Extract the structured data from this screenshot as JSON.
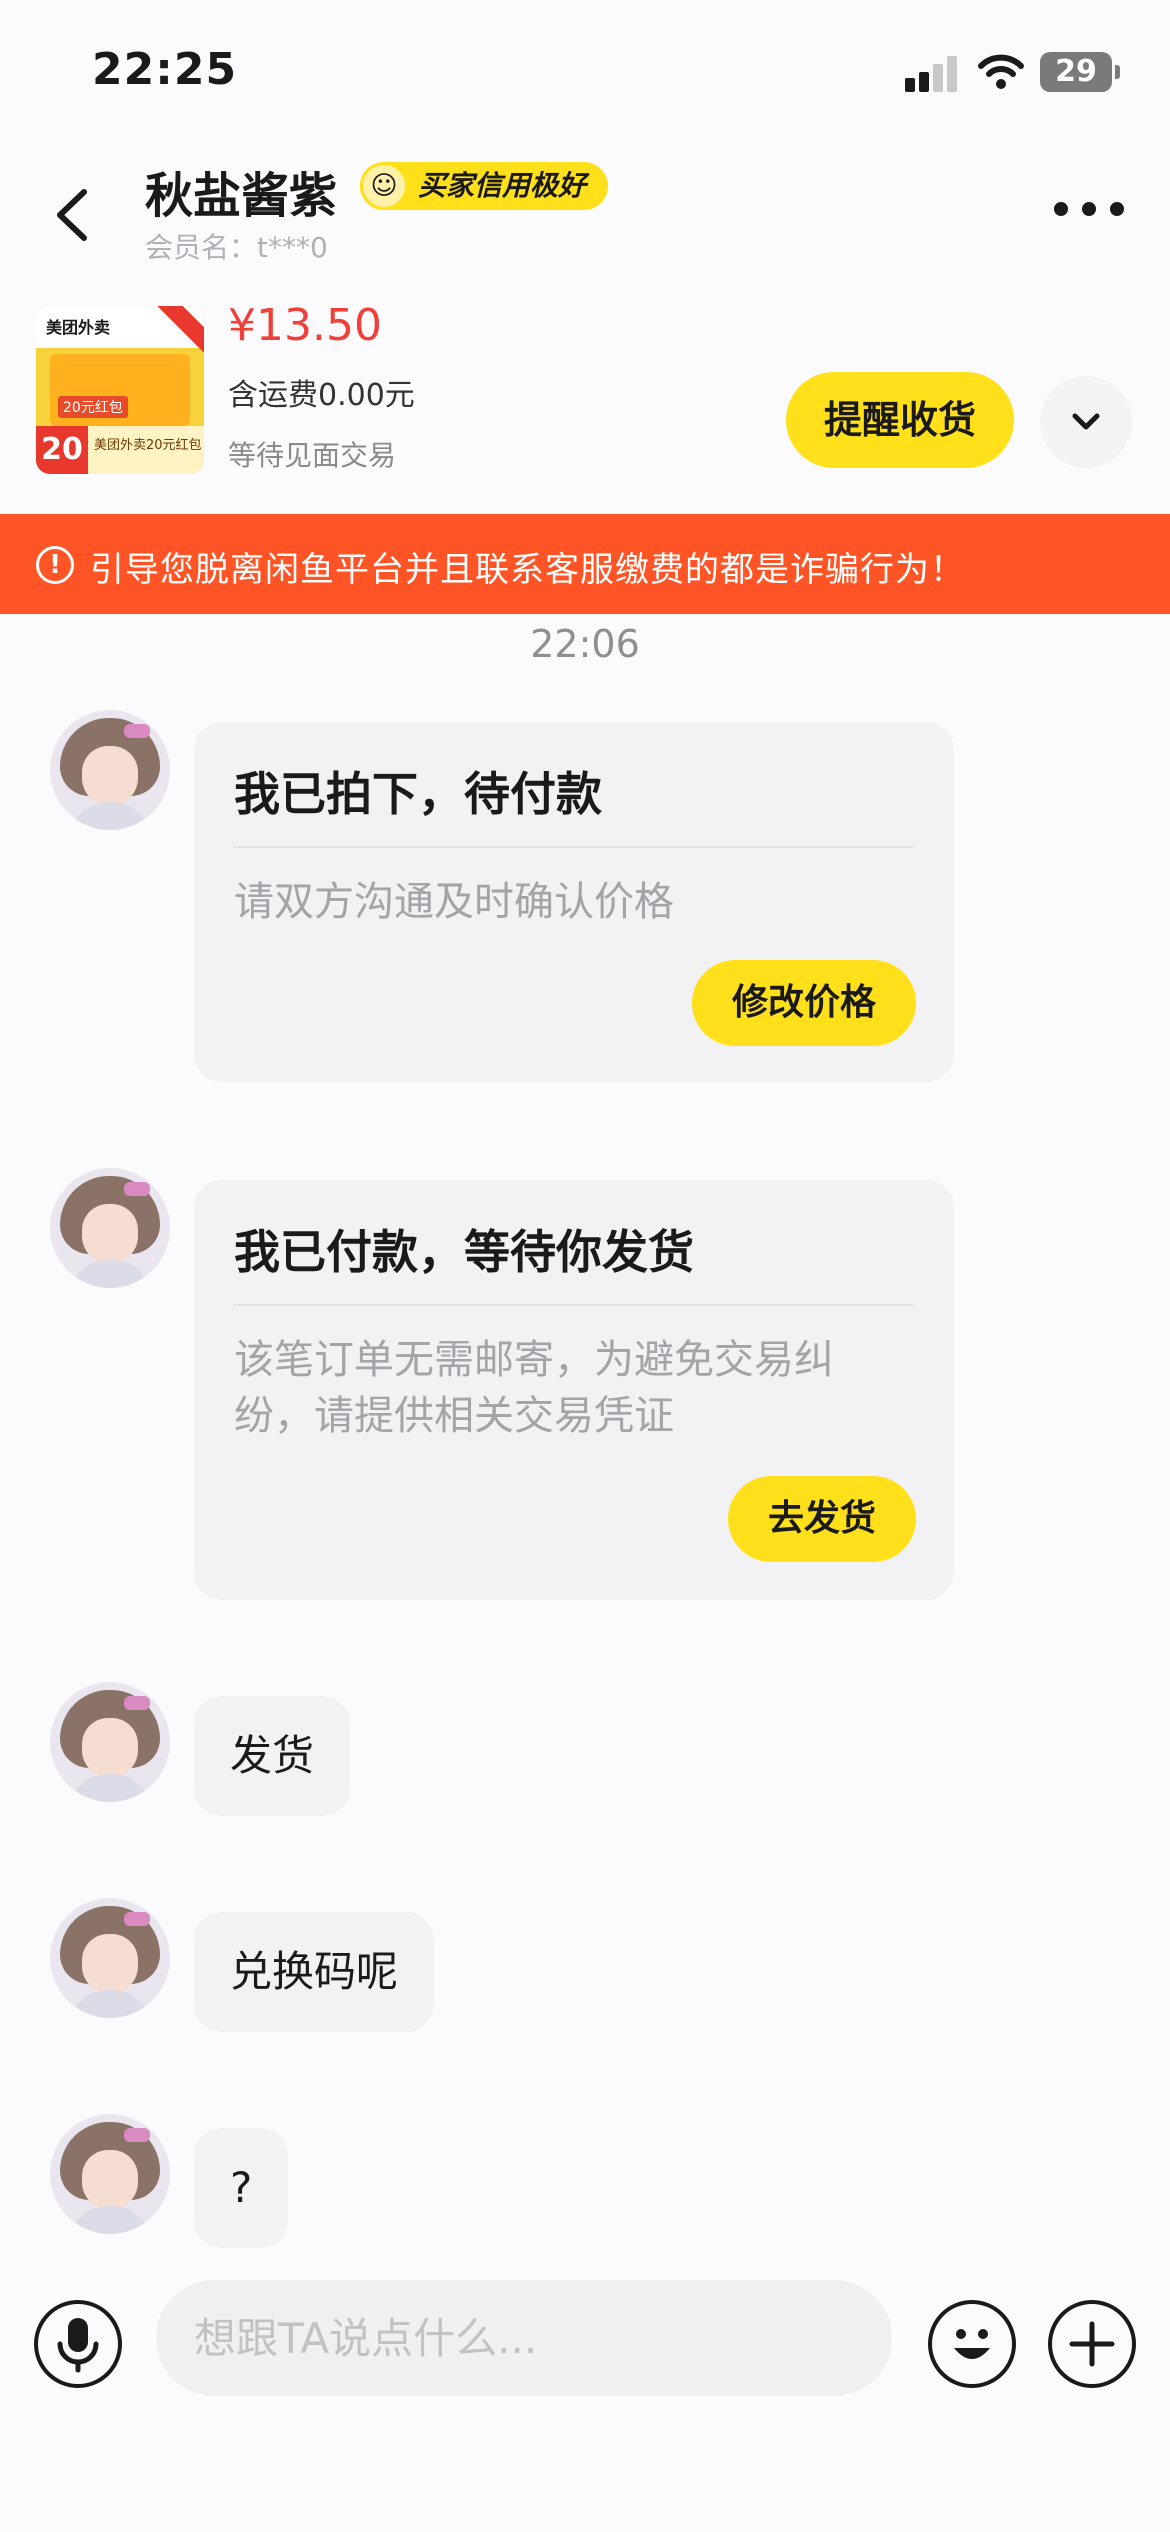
{
  "status_bar": {
    "time": "22:25",
    "battery": "29"
  },
  "header": {
    "contact_name": "秋盐酱紫",
    "credit_badge": "买家信用极好",
    "member_name": "会员名：t***0"
  },
  "product": {
    "price": "¥13.50",
    "shipping": "含运费0.00元",
    "trade_status": "等待见面交易",
    "remind_button": "提醒收货",
    "thumb_logo": "美团外卖",
    "thumb_tag": "20元红包",
    "thumb_number": "20",
    "thumb_sub": "美团外卖20元红包"
  },
  "warning": {
    "icon": "!",
    "text": "引导您脱离闲鱼平台并且联系客服缴费的都是诈骗行为！"
  },
  "chat": {
    "time": "22:06",
    "cards": [
      {
        "title": "我已拍下，待付款",
        "body": "请双方沟通及时确认价格",
        "button": "修改价格"
      },
      {
        "title": "我已付款，等待你发货",
        "body": "该笔订单无需邮寄，为避免交易纠纷，请提供相关交易凭证",
        "button": "去发货"
      }
    ],
    "messages": [
      "发货",
      "兑换码呢",
      "?"
    ]
  },
  "input": {
    "placeholder": "想跟TA说点什么..."
  },
  "icons": {
    "back": "chevron-left-icon",
    "more": "more-dots-icon",
    "expand": "chevron-down-icon",
    "mic": "microphone-icon",
    "emoji": "emoji-icon",
    "plus": "plus-icon"
  },
  "colors": {
    "accent_yellow": "#ffe01a",
    "warning_orange": "#ff5526",
    "price_red": "#f0403a"
  }
}
